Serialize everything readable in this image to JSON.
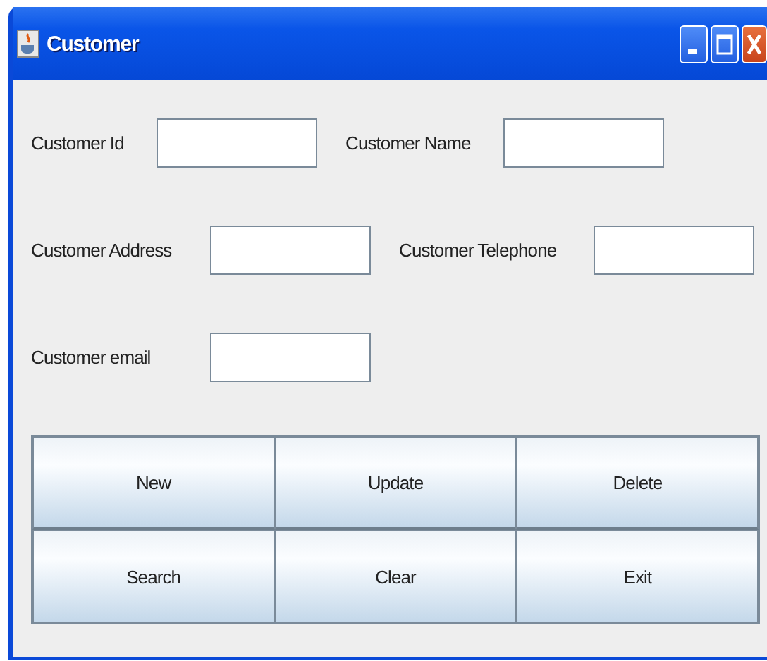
{
  "window": {
    "title": "Customer"
  },
  "field_rows": [
    [
      {
        "label": "Customer Id"
      },
      {
        "label": "Customer Name"
      }
    ],
    [
      {
        "label": "Customer Address"
      },
      {
        "label": "Customer Telephone"
      }
    ],
    [
      {
        "label": "Customer email"
      }
    ]
  ],
  "buttons": [
    "New",
    "Update",
    "Delete",
    "Search",
    "Clear",
    "Exit"
  ]
}
